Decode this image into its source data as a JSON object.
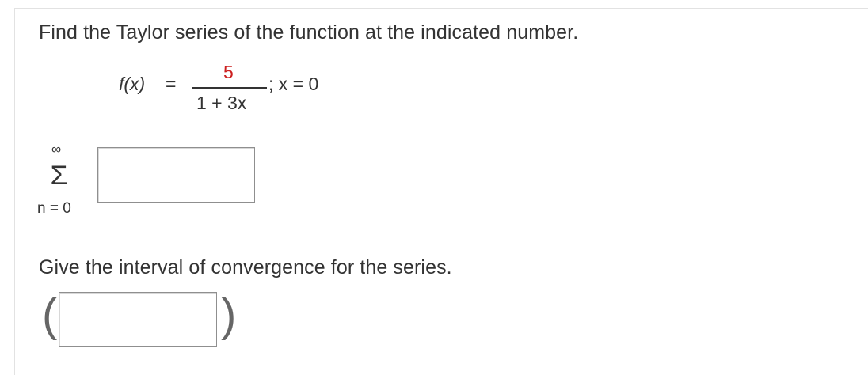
{
  "question": {
    "prompt": "Find the Taylor series of the function at the indicated number.",
    "function_lhs": "f(x)",
    "equals": "=",
    "numerator": "5",
    "denominator": "1 + 3x",
    "point": "; x = 0",
    "numerator_color": "#cc1f1f"
  },
  "series": {
    "upper_limit": "∞",
    "sigma": "Σ",
    "lower_limit": "n = 0",
    "answer_value": ""
  },
  "interval": {
    "prompt": "Give the interval of convergence for the series.",
    "left_paren": "(",
    "right_paren": ")",
    "answer_value": ""
  }
}
